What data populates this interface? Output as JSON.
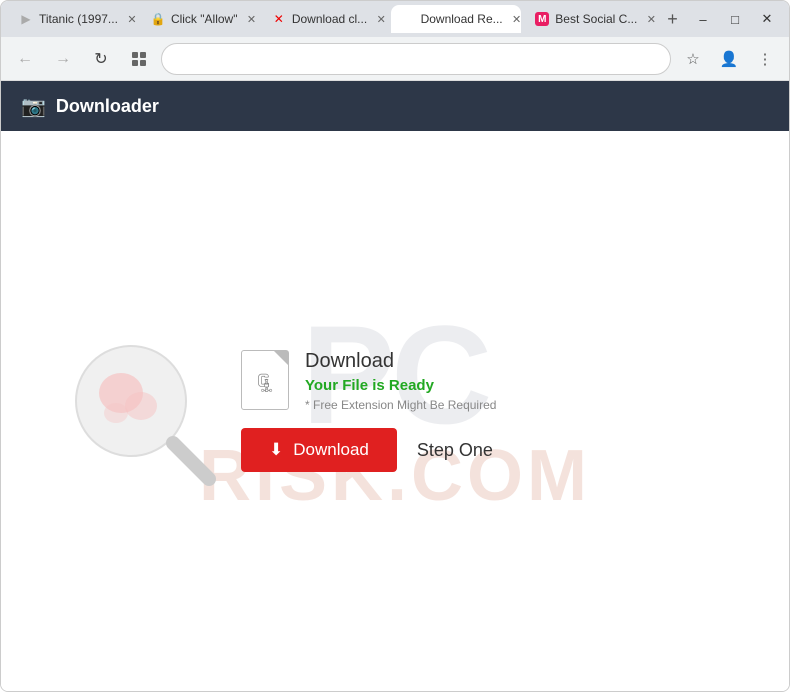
{
  "browser": {
    "tabs": [
      {
        "id": "tab1",
        "label": "Titanic (1997...",
        "active": false,
        "icon": "▶",
        "icon_color": "#aaa"
      },
      {
        "id": "tab2",
        "label": "Click \"Allow\"",
        "active": false,
        "icon": "🔒",
        "icon_color": "#aaa"
      },
      {
        "id": "tab3",
        "label": "Download cl...",
        "active": false,
        "icon": "✕",
        "icon_color": "#e00",
        "close_icon_color": "#e00"
      },
      {
        "id": "tab4",
        "label": "Download Re...",
        "active": true,
        "icon": "",
        "icon_color": "#aaa"
      },
      {
        "id": "tab5",
        "label": "Best Social C...",
        "active": false,
        "icon": "M",
        "icon_color": "#e91e63"
      }
    ],
    "address": "",
    "new_tab_label": "+"
  },
  "nav": {
    "back_label": "←",
    "forward_label": "→",
    "reload_label": "↻",
    "extensions_label": "⊞",
    "bookmark_label": "☆",
    "profile_label": "👤",
    "menu_label": "⋮"
  },
  "win_controls": {
    "minimize": "–",
    "maximize": "□",
    "close": "✕"
  },
  "header": {
    "icon": "📷",
    "title": "Downloader"
  },
  "main": {
    "download_title": "Download",
    "file_ready": "Your File is Ready",
    "note": "* Free Extension Might Be Required",
    "download_btn_label": "Download",
    "download_btn_icon": "⬇",
    "step_one_label": "Step One"
  },
  "watermark": {
    "pc_text": "PC",
    "risk_text": "RISK.COM"
  }
}
